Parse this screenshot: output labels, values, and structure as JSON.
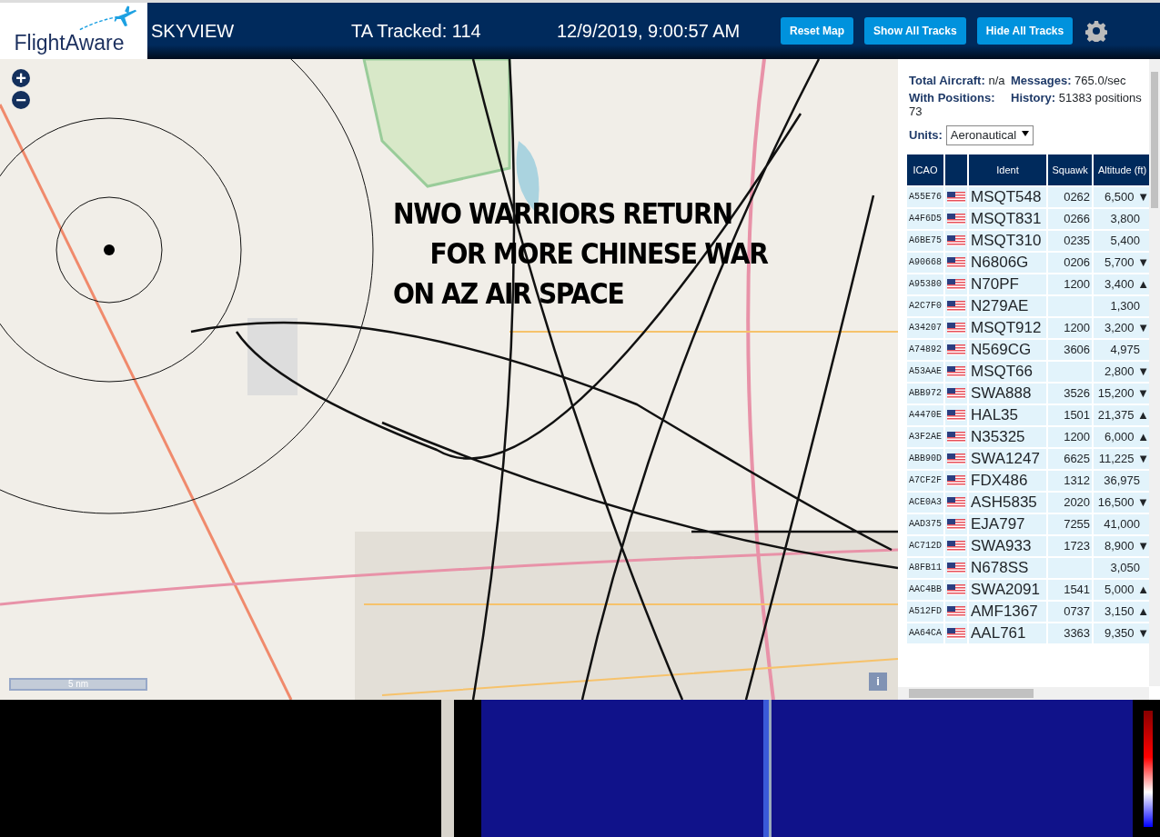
{
  "header": {
    "logo": "FlightAware",
    "title": "SKYVIEW",
    "tracked": "TA Tracked: 114",
    "datetime": "12/9/2019, 9:00:57 AM",
    "buttons": [
      "Reset Map",
      "Show All Tracks",
      "Hide All Tracks"
    ]
  },
  "map": {
    "kind": "picture",
    "zoom_in": "+",
    "zoom_out": "−",
    "scale": "5 nm",
    "info": "i",
    "caption": [
      "NWO WARRIORS RETURN",
      "FOR MORE CHINESE WAR",
      "ON AZ AIR SPACE"
    ]
  },
  "stats": [
    {
      "label": "Total Aircraft:",
      "value": "n/a"
    },
    {
      "label": "Messages:",
      "value": "765.0/sec"
    },
    {
      "label": "With Positions:",
      "value": "73"
    },
    {
      "label": "History:",
      "value": "51383 positions"
    }
  ],
  "units": {
    "label": "Units:",
    "value": "Aeronautical"
  },
  "table": {
    "columns": [
      "ICAO",
      "",
      "Ident",
      "Squawk",
      "Altitude (ft)"
    ],
    "rows": [
      {
        "icao": "A55E76",
        "ident": "MSQT548",
        "squawk": "0262",
        "altitude": "6,500",
        "trend": "▼"
      },
      {
        "icao": "A4F6D5",
        "ident": "MSQT831",
        "squawk": "0266",
        "altitude": "3,800"
      },
      {
        "icao": "A6BE75",
        "ident": "MSQT310",
        "squawk": "0235",
        "altitude": "5,400"
      },
      {
        "icao": "A90668",
        "ident": "N6806G",
        "squawk": "0206",
        "altitude": "5,700",
        "trend": "▼"
      },
      {
        "icao": "A95380",
        "ident": "N70PF",
        "squawk": "1200",
        "altitude": "3,400",
        "trend": "▲"
      },
      {
        "icao": "A2C7F0",
        "ident": "N279AE",
        "altitude": "1,300"
      },
      {
        "icao": "A34207",
        "ident": "MSQT912",
        "squawk": "1200",
        "altitude": "3,200",
        "trend": "▼"
      },
      {
        "icao": "A74892",
        "ident": "N569CG",
        "squawk": "3606",
        "altitude": "4,975"
      },
      {
        "icao": "A53AAE",
        "ident": "MSQT66",
        "altitude": "2,800",
        "trend": "▼"
      },
      {
        "icao": "ABB972",
        "ident": "SWA888",
        "squawk": "3526",
        "altitude": "15,200",
        "trend": "▼"
      },
      {
        "icao": "A4470E",
        "ident": "HAL35",
        "squawk": "1501",
        "altitude": "21,375",
        "trend": "▲"
      },
      {
        "icao": "A3F2AE",
        "ident": "N35325",
        "squawk": "1200",
        "altitude": "6,000",
        "trend": "▲"
      },
      {
        "icao": "ABB90D",
        "ident": "SWA1247",
        "squawk": "6625",
        "altitude": "11,225",
        "trend": "▼"
      },
      {
        "icao": "A7CF2F",
        "ident": "FDX486",
        "squawk": "1312",
        "altitude": "36,975"
      },
      {
        "icao": "ACE0A3",
        "ident": "ASH5835",
        "squawk": "2020",
        "altitude": "16,500",
        "trend": "▼"
      },
      {
        "icao": "AAD375",
        "ident": "EJA797",
        "squawk": "7255",
        "altitude": "41,000"
      },
      {
        "icao": "AC712D",
        "ident": "SWA933",
        "squawk": "1723",
        "altitude": "8,900",
        "trend": "▼"
      },
      {
        "icao": "A8FB11",
        "ident": "N678SS",
        "altitude": "3,050"
      },
      {
        "icao": "AAC4BB",
        "ident": "SWA2091",
        "squawk": "1541",
        "altitude": "5,000",
        "trend": "▲"
      },
      {
        "icao": "A512FD",
        "ident": "AMF1367",
        "squawk": "0737",
        "altitude": "3,150",
        "trend": "▲"
      },
      {
        "icao": "AA64CA",
        "ident": "AAL761",
        "squawk": "3363",
        "altitude": "9,350",
        "trend": "▼"
      }
    ]
  }
}
